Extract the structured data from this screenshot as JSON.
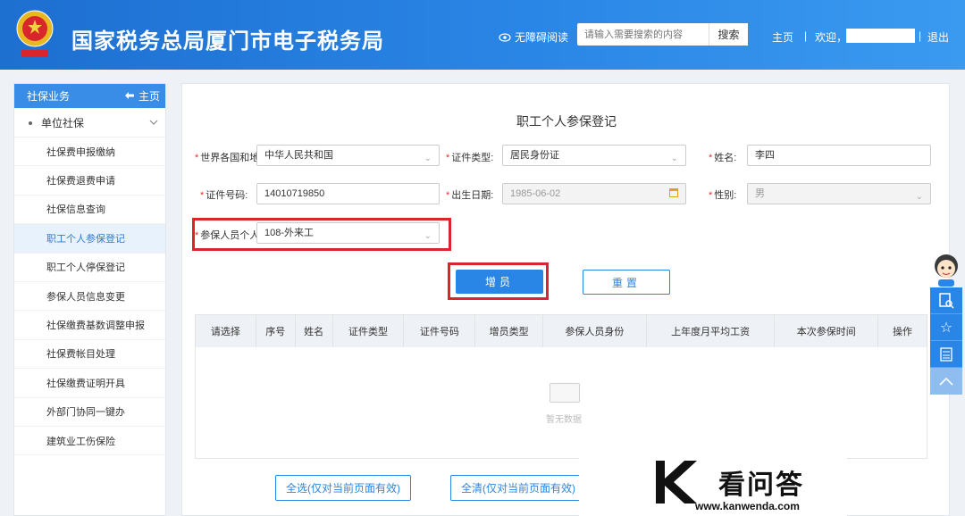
{
  "header": {
    "title": "国家税务总局厦门市电子税务局",
    "accessible_label": "无障碍阅读",
    "search_placeholder": "请输入需要搜索的内容",
    "search_button": "搜索",
    "home_link": "主页",
    "separator": "|",
    "welcome": "欢迎，",
    "logout": "退出"
  },
  "sidebar": {
    "header_title": "社保业务",
    "header_home": "主页",
    "group": "单位社保",
    "items": [
      {
        "label": "社保费申报缴纳"
      },
      {
        "label": "社保费退费申请"
      },
      {
        "label": "社保信息查询"
      },
      {
        "label": "职工个人参保登记"
      },
      {
        "label": "职工个人停保登记"
      },
      {
        "label": "参保人员信息变更"
      },
      {
        "label": "社保缴费基数调整申报"
      },
      {
        "label": "社保费帐目处理"
      },
      {
        "label": "社保缴费证明开具"
      },
      {
        "label": "外部门协同一键办"
      },
      {
        "label": "建筑业工伤保险"
      }
    ]
  },
  "form": {
    "title": "职工个人参保登记",
    "country_label": "世界各国和地区",
    "country_value": "中华人民共和国",
    "id_type_label": "证件类型:",
    "id_type_value": "居民身份证",
    "name_label": "姓名:",
    "name_value": "李四",
    "id_no_label": "证件号码:",
    "id_no_value": "14010719850",
    "birth_label": "出生日期:",
    "birth_value": "1985-06-02",
    "gender_label": "性别:",
    "gender_value": "男",
    "identity_label": "参保人员个人身份",
    "identity_value": "108-外来工",
    "add_button": "增员",
    "reset_button": "重置"
  },
  "table": {
    "columns": [
      "请选择",
      "序号",
      "姓名",
      "证件类型",
      "证件号码",
      "增员类型",
      "参保人员身份",
      "上年度月平均工资",
      "本次参保时间",
      "操作"
    ],
    "empty_text": "暂无数据"
  },
  "footer_buttons": {
    "select_all": "全选(仅对当前页面有效)",
    "clear_all": "全清(仅对当前页面有效)"
  },
  "watermark": {
    "brand": "看问答",
    "url": "www.kanwenda.com"
  },
  "colors": {
    "brand_blue": "#2a86e6",
    "highlight_red": "#d9262c"
  }
}
